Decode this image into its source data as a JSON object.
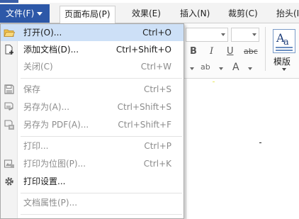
{
  "tabs": {
    "file": "文件(F)",
    "items": [
      "页面布局(P)",
      "效果(E)",
      "插入(N)",
      "裁剪(C)",
      "抬头(I)"
    ]
  },
  "ribbon": {
    "bold": "B",
    "italic": "I",
    "underline": "U",
    "strike": "abc",
    "highlight": "ab",
    "font_color": "A",
    "template_label": "模版"
  },
  "menu": {
    "items": [
      {
        "label": "打开(O)...",
        "shortcut": "Ctrl+O",
        "icon": "folder-open-icon",
        "disabled": false,
        "highlighted": true
      },
      {
        "label": "添加文档(D)...",
        "shortcut": "Ctrl+Shift+O",
        "icon": "add-document-icon",
        "disabled": false
      },
      {
        "label": "关闭(C)",
        "shortcut": "Ctrl+W",
        "icon": "",
        "disabled": true
      },
      {
        "label": "保存",
        "shortcut": "Ctrl+S",
        "icon": "save-icon",
        "disabled": true
      },
      {
        "label": "另存为(A)...",
        "shortcut": "Ctrl+Shift+S",
        "icon": "save-as-icon",
        "disabled": true
      },
      {
        "label": "另存为 PDF(A)...",
        "shortcut": "Ctrl+Shift+F",
        "icon": "save-as-pdf-icon",
        "disabled": true
      },
      {
        "label": "打印...",
        "shortcut": "Ctrl+P",
        "icon": "",
        "disabled": true
      },
      {
        "label": "打印为位图(P)...",
        "shortcut": "Ctrl+K",
        "icon": "print-bitmap-icon",
        "disabled": true
      },
      {
        "label": "打印设置...",
        "shortcut": "",
        "icon": "gear-icon",
        "disabled": false
      },
      {
        "label": "文档属性(P)...",
        "shortcut": "",
        "icon": "",
        "disabled": true
      }
    ]
  },
  "colors": {
    "file_tab": "#2d58a8",
    "highlight": "#cde0f7",
    "disabled_text": "#8c8c8c"
  }
}
